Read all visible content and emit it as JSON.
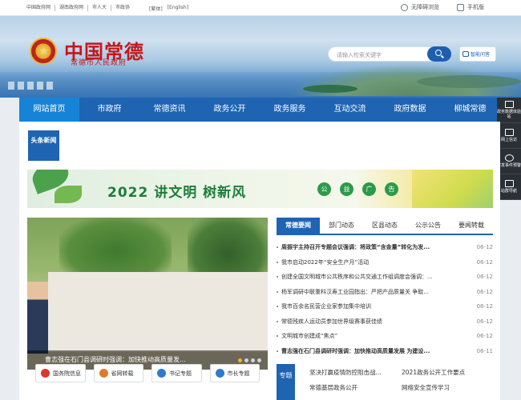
{
  "topbar": {
    "links": [
      "中国政府网",
      "湖南政府网",
      "市人大",
      "市政协"
    ],
    "lang": [
      "[繁体]",
      "[English]"
    ],
    "accessibility": "无障碍浏览",
    "mobile": "手机版"
  },
  "header": {
    "logo_main": "中国常德",
    "logo_sub": "常德市人民政府",
    "search_placeholder": "请输入检索关键字",
    "ask_label": "智能问答"
  },
  "nav": {
    "items": [
      "网站首页",
      "市政府",
      "常德资讯",
      "政务公开",
      "政务服务",
      "互动交流",
      "政府数据",
      "柳城常德"
    ],
    "active": 0
  },
  "sidetools": [
    {
      "label": "政务数据体验站",
      "icon": "data-icon"
    },
    {
      "label": "网上信访",
      "icon": "mail-icon"
    },
    {
      "label": "突发事件预警",
      "icon": "alert-icon"
    },
    {
      "label": "站群导航",
      "icon": "sitemap-icon"
    }
  ],
  "headline_tag": "头条新闻",
  "ad": {
    "text": "2022 讲文明 树新风",
    "pills": [
      "公",
      "益",
      "广",
      "告"
    ]
  },
  "photo": {
    "caption": "曹志强在石门县调研时强调：加快推动高质量发..."
  },
  "tabs": [
    "常德要闻",
    "部门动态",
    "区县动态",
    "公示公告",
    "要闻转载"
  ],
  "news": [
    {
      "title": "周振宇主持召开专题会议强调：将政策“含金量”转化为发...",
      "date": "06-12",
      "bold": true
    },
    {
      "title": "我市启动2022年“安全生产月”活动",
      "date": "06-12",
      "bold": false
    },
    {
      "title": "创建全国文明城市公共秩序和公共交通工作组调度会强调：...",
      "date": "06-12",
      "bold": false
    },
    {
      "title": "杨军调研中联重科汉寿工业园指出：严把产品质量关 争取...",
      "date": "06-12",
      "bold": false
    },
    {
      "title": "我市百余名民营企业家参加集中培训",
      "date": "06-12",
      "bold": false
    },
    {
      "title": "常德残疾人运动员参加世界级赛事获佳绩",
      "date": "06-12",
      "bold": false
    },
    {
      "title": "文明城市创建成“焦点”",
      "date": "06-12",
      "bold": false
    },
    {
      "title": "曹志强在石门县调研时强调：加快推动高质量发展 为建设...",
      "date": "06-11",
      "bold": true
    }
  ],
  "quick": [
    {
      "label": "国务院信息",
      "color": "#d8392b"
    },
    {
      "label": "省网转载",
      "color": "#e07b2a"
    },
    {
      "label": "书记专题",
      "color": "#2d7bd1"
    },
    {
      "label": "市长专题",
      "color": "#2d7bd1"
    }
  ],
  "special": {
    "tag": "专题",
    "items": [
      "坚决打赢疫情防控阻击战...",
      "2021政务公开工作要点",
      "常德基层政务公开",
      "网络安全宣传学习"
    ]
  }
}
